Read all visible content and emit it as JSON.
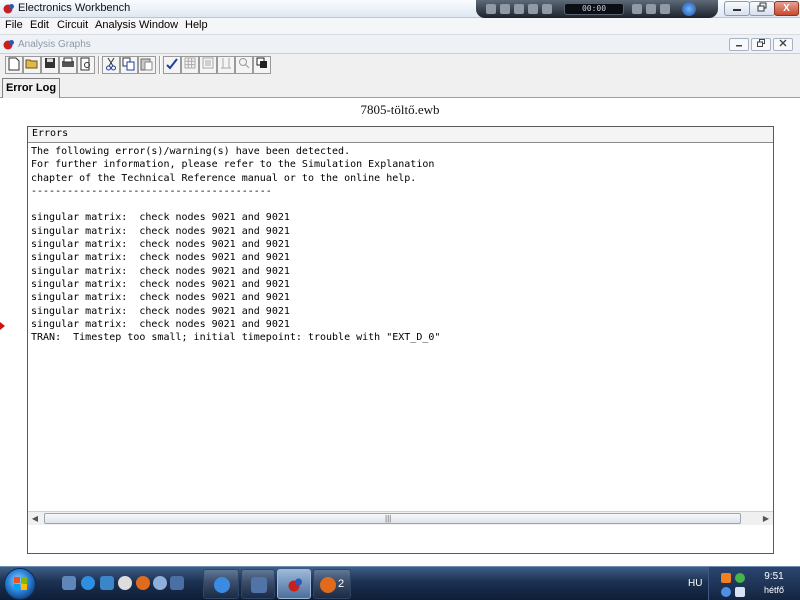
{
  "window": {
    "title": "Electronics Workbench",
    "close_label": "X"
  },
  "media": {
    "time": "00:00"
  },
  "menu": [
    "File",
    "Edit",
    "Circuit",
    "Analysis",
    "Window",
    "Help"
  ],
  "child_window": {
    "title": "Analysis Graphs"
  },
  "tab": {
    "label": "Error Log"
  },
  "document": {
    "filename": "7805-töltő.ewb"
  },
  "errors": {
    "title": "Errors",
    "lines": [
      "The following error(s)/warning(s) have been detected.",
      "For further information, please refer to the Simulation Explanation",
      "chapter of the Technical Reference manual or to the online help.",
      "----------------------------------------",
      "",
      "singular matrix:  check nodes 9021 and 9021",
      "singular matrix:  check nodes 9021 and 9021",
      "singular matrix:  check nodes 9021 and 9021",
      "singular matrix:  check nodes 9021 and 9021",
      "singular matrix:  check nodes 9021 and 9021",
      "singular matrix:  check nodes 9021 and 9021",
      "singular matrix:  check nodes 9021 and 9021",
      "singular matrix:  check nodes 9021 and 9021",
      "singular matrix:  check nodes 9021 and 9021",
      "TRAN:  Timestep too small; initial timepoint: trouble with \"EXT_D_0\""
    ]
  },
  "taskbar": {
    "firefox_count": "2",
    "language": "HU",
    "clock_time": "9:51",
    "clock_day": "hétfő"
  }
}
